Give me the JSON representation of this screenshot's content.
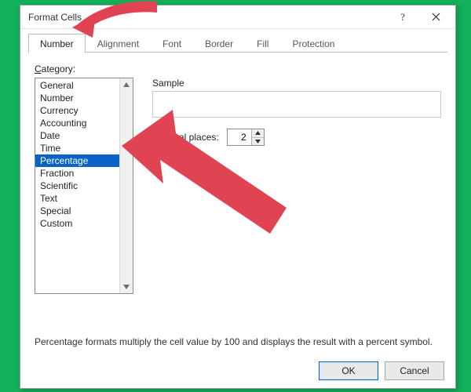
{
  "title": "Format Cells",
  "tabs": [
    "Number",
    "Alignment",
    "Font",
    "Border",
    "Fill",
    "Protection"
  ],
  "active_tab": 0,
  "category_label_pre": "C",
  "category_label_rest": "ategory:",
  "categories": [
    "General",
    "Number",
    "Currency",
    "Accounting",
    "Date",
    "Time",
    "Percentage",
    "Fraction",
    "Scientific",
    "Text",
    "Special",
    "Custom"
  ],
  "selected_category_index": 6,
  "sample_label": "Sample",
  "decimal_label_pre": "D",
  "decimal_label_rest": "ecimal places:",
  "decimal_places": "2",
  "description": "Percentage formats multiply the cell value by 100 and displays the result with a percent symbol.",
  "buttons": {
    "ok": "OK",
    "cancel": "Cancel"
  },
  "icons": {
    "help": "?",
    "close": "✕"
  },
  "annotation_color": "#e04453"
}
